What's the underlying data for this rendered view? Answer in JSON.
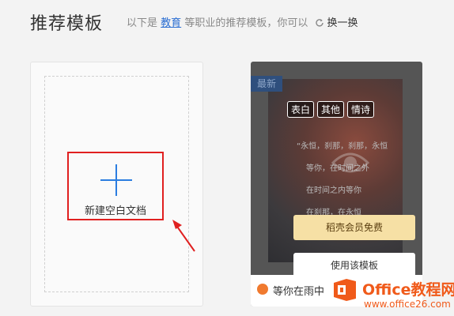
{
  "header": {
    "title": "推荐模板",
    "subtitle_prefix": "以下是",
    "subtitle_link": "教育",
    "subtitle_suffix": "等职业的推荐模板，你可以",
    "refresh_label": "换一换"
  },
  "blank_card": {
    "label": "新建空白文档"
  },
  "template_card": {
    "badge": "最新",
    "tags": [
      "表白",
      "其他",
      "情诗"
    ],
    "poem_lines": [
      "“永恒，刹那，刹那，永恒",
      "等你，在时间之外",
      "在时间之内等你",
      "在刹那，在永恒"
    ],
    "member_button": "稻壳会员免费",
    "use_button": "使用该模板",
    "name": "等你在雨中"
  },
  "watermark": {
    "brand": "Office教程网",
    "url": "www.office26.com"
  },
  "colors": {
    "accent_blue": "#2b7de0",
    "highlight_red": "#e02020",
    "member_gold": "#f6e0a5",
    "watermark_orange": "#f05a1a"
  }
}
